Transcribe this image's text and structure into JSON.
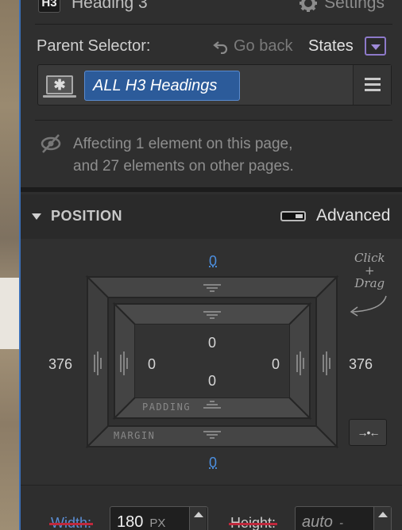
{
  "header": {
    "element_badge": "H3",
    "element_title": "Heading 3",
    "settings_label": "Settings"
  },
  "selector": {
    "parent_label": "Parent Selector:",
    "go_back_label": "Go back",
    "states_label": "States",
    "selector_icon_glyph": "✱",
    "tag_label": "ALL H3 Headings",
    "affect_line1": "Affecting 1 element on this page,",
    "affect_line2": "and 27 elements on other pages."
  },
  "position": {
    "title": "POSITION",
    "advanced_label": "Advanced",
    "hint_line1": "Click",
    "hint_line2": "+",
    "hint_line3": "Drag",
    "margin_top": "0",
    "margin_bottom": "0",
    "margin_left": "376",
    "margin_right": "376",
    "padding_top": "0",
    "padding_bottom": "0",
    "padding_left": "0",
    "padding_right": "0",
    "padding_label": "PADDING",
    "margin_label": "MARGIN",
    "collapse_glyph": "→•←"
  },
  "size": {
    "width_label": "Width:",
    "width_value": "180",
    "width_unit": "PX",
    "height_label": "Height:",
    "height_value": "auto",
    "height_unit": "-"
  },
  "colors": {
    "accent_blue": "#2c5b9a",
    "link_blue": "#4c8fe0",
    "states_purple": "#8d79c9",
    "strike_red": "#c0283c"
  }
}
